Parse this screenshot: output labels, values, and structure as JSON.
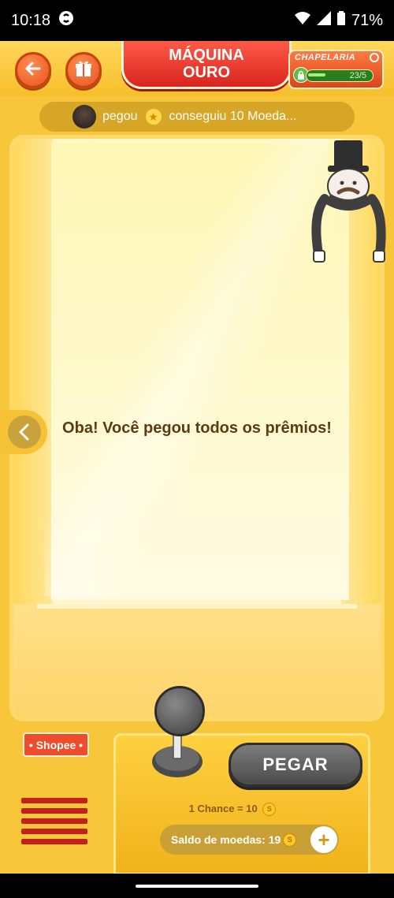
{
  "status_bar": {
    "time": "10:18",
    "battery": "71%",
    "icons": [
      "shazam-icon",
      "wifi-icon",
      "signal-icon",
      "battery-icon"
    ]
  },
  "header": {
    "back_icon": "arrow-left-icon",
    "gift_icon": "gift-icon",
    "title_line1": "MÁQUINA",
    "title_line2": "OURO",
    "chapelaria": {
      "label": "CHAPELARIA",
      "progress_text": "23/5",
      "progress": 1.0
    }
  },
  "ticker": {
    "user": "pegou",
    "message": "conseguiu 10 Moeda..."
  },
  "machine": {
    "message": "Oba! Você pegou todos os prêmios!"
  },
  "controls": {
    "brand": "• Shopee •",
    "grab_label": "PEGAR",
    "chance_text": "1 Chance = 10",
    "balance_text": "Saldo de moedas: 19",
    "coin_symbol": "S"
  },
  "colors": {
    "accent_red": "#d8251e",
    "gold": "#f6c336",
    "shopee": "#ee4d2d"
  }
}
